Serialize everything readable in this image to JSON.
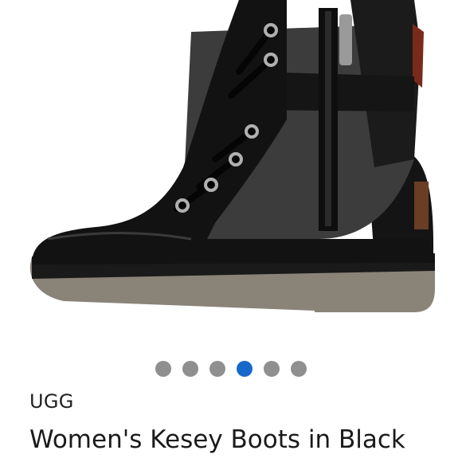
{
  "product": {
    "brand": "UGG",
    "title": "Women's Kesey Boots in Black",
    "image_icon": "boot-image"
  },
  "carousel": {
    "count": 6,
    "active_index": 3,
    "dot_color": "#8f8f8f",
    "active_color": "#1769c9"
  }
}
